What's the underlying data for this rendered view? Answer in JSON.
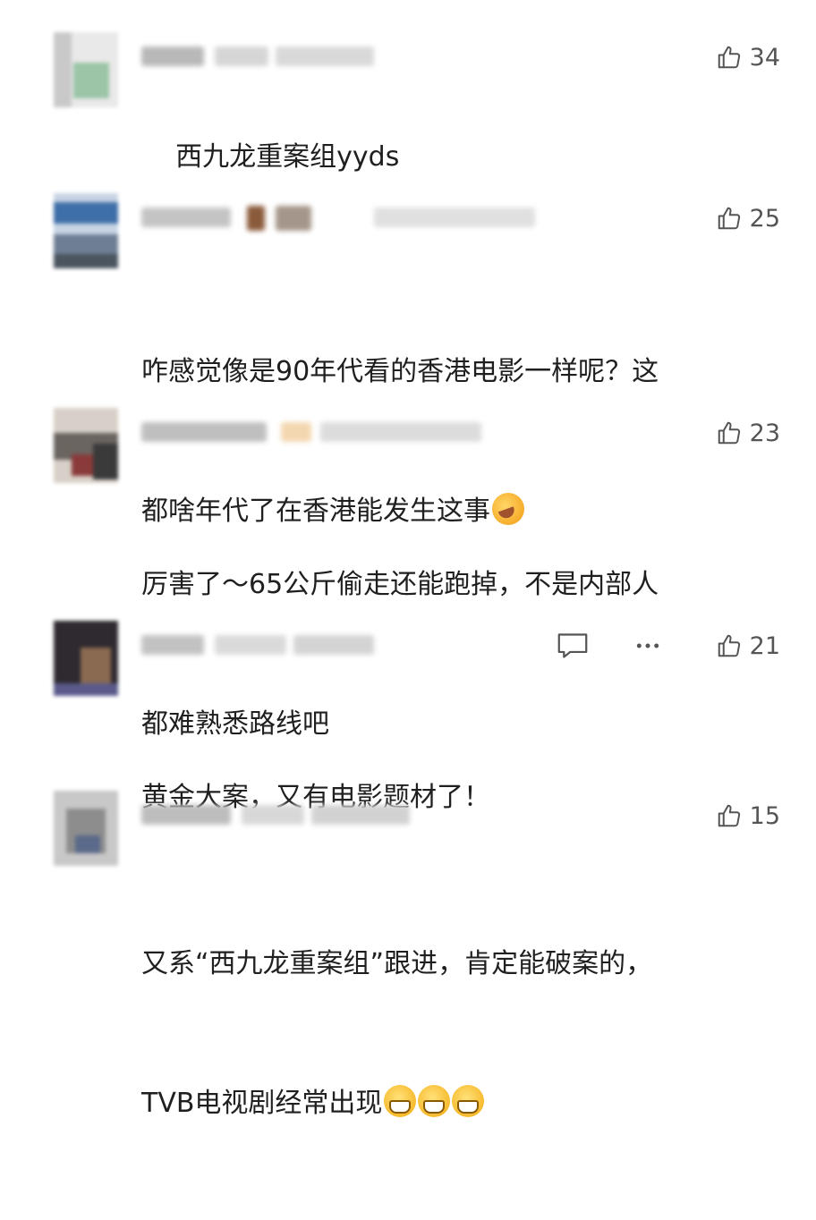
{
  "comments": [
    {
      "lines": [
        "西九龙重案组yyds"
      ],
      "likes": "34",
      "emoji": []
    },
    {
      "lines": [
        "咋感觉像是90年代看的香港电影一样呢？这",
        "都啥年代了在香港能发生这事"
      ],
      "likes": "25",
      "emoji": [
        "laugh"
      ]
    },
    {
      "lines": [
        "厉害了～65公斤偷走还能跑掉，不是内部人",
        "都难熟悉路线吧"
      ],
      "likes": "23",
      "emoji": []
    },
    {
      "lines": [
        "黄金大案，又有电影题材了！"
      ],
      "likes": "21",
      "emoji": [],
      "show_actions": true
    },
    {
      "lines": [
        "又系“西九龙重案组”跟进，肯定能破案的，",
        "TVB电视剧经常出现"
      ],
      "likes": "15",
      "emoji": [
        "grin",
        "grin",
        "grin"
      ]
    }
  ],
  "icons": {
    "like": "thumbs-up-icon",
    "reply": "comment-icon",
    "more": "more-icon"
  },
  "colors": {
    "text": "#1f1f1f",
    "icon": "#555555"
  }
}
